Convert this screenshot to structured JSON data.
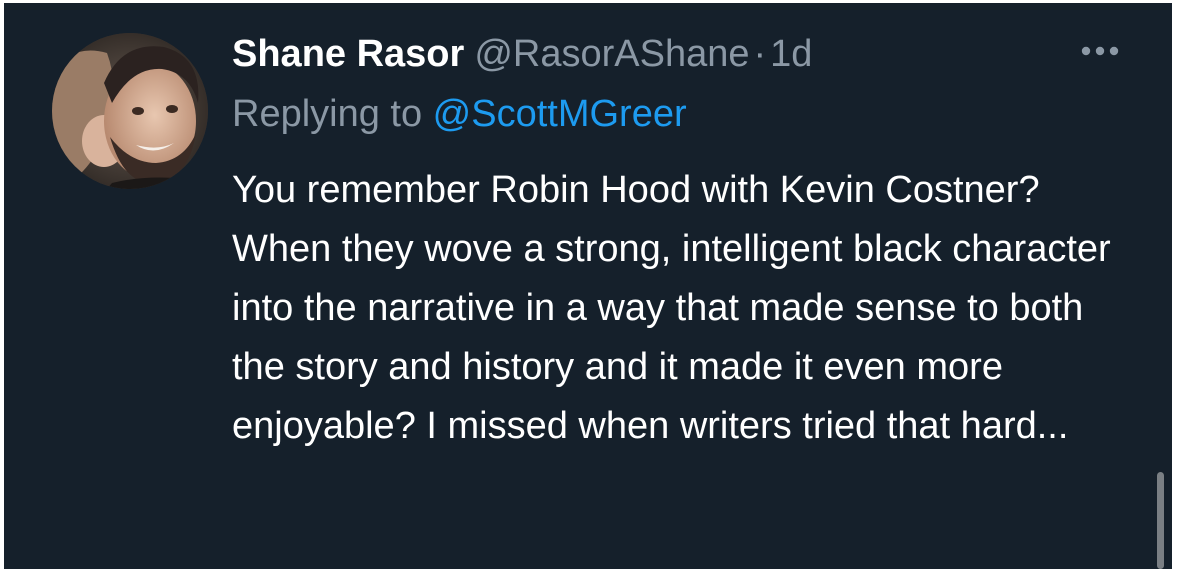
{
  "tweet": {
    "display_name": "Shane Rasor",
    "handle": "@RasorAShane",
    "separator": "·",
    "time": "1d",
    "replying_prefix": "Replying to ",
    "replying_to": "@ScottMGreer",
    "text": "You remember Robin Hood with Kevin Costner? When they wove a strong, intelligent black character into the narrative in a way that made sense to both the story and history and it made it even more enjoyable? I missed when writers tried that hard...",
    "more_icon": "more-horizontal-icon"
  },
  "colors": {
    "background": "#15202b",
    "primary_text": "#ffffff",
    "secondary_text": "#8b98a5",
    "link": "#1d9bf0"
  }
}
